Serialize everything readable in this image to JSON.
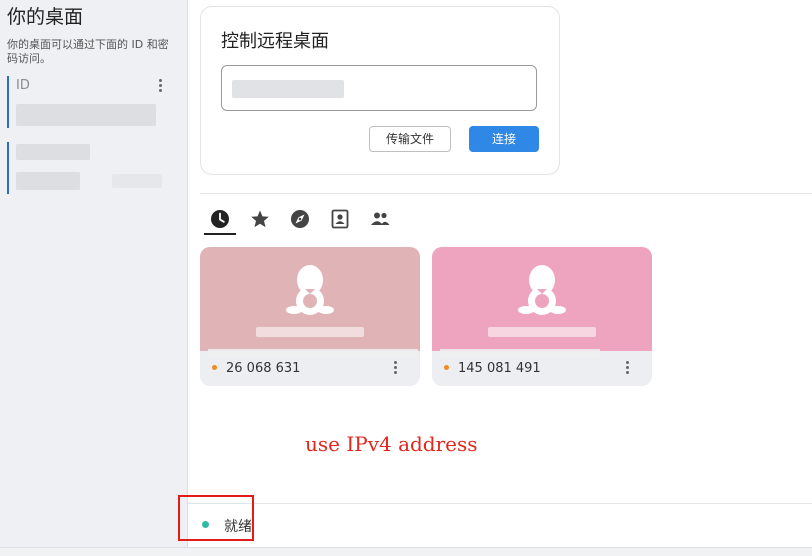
{
  "sidebar": {
    "title": "你的桌面",
    "description": "你的桌面可以通过下面的 ID 和密码访问。",
    "id_label": "ID"
  },
  "control": {
    "title": "控制远程桌面",
    "transfer_button": "传输文件",
    "connect_button": "连接"
  },
  "tabs": [
    {
      "name": "recent",
      "icon": "clock-icon"
    },
    {
      "name": "favorites",
      "icon": "star-icon"
    },
    {
      "name": "discovered",
      "icon": "compass-icon"
    },
    {
      "name": "address-book",
      "icon": "contact-book-icon"
    },
    {
      "name": "group",
      "icon": "people-icon"
    }
  ],
  "peers": [
    {
      "id": "26 068 631",
      "color": "#e0b4b6",
      "icon": "linux-icon"
    },
    {
      "id": "145 081 491",
      "color": "#eea4bf",
      "icon": "linux-icon"
    }
  ],
  "annotation": "use IPv4 address",
  "status": {
    "text": "就绪",
    "color": "#32b9a4"
  },
  "colors": {
    "accent": "#2f87e6",
    "annotation": "#e0281e"
  }
}
